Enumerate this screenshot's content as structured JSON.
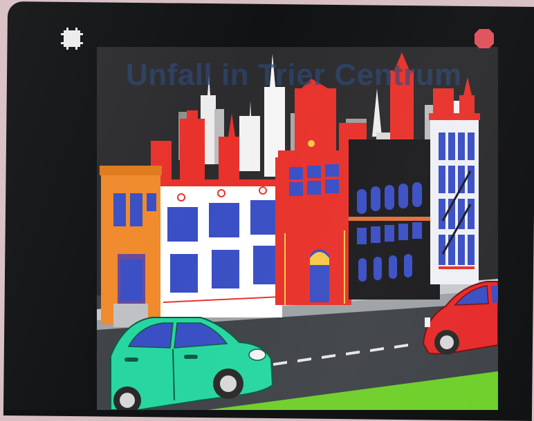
{
  "game": {
    "title": "Unfall in Trier Centrum"
  },
  "hud": {
    "left_icon": "frame-icon",
    "right_icon": "stop-icon"
  },
  "colors": {
    "bezel": "#111214",
    "sky": "#2c2c2f",
    "skyline_red": "#e8322b",
    "skyline_white": "#ececec",
    "skyline_gray": "#9a9a9a",
    "orange_house": "#f08a2c",
    "window_blue": "#3a4fc4",
    "road": "#3f4348",
    "grass": "#6fcf2a",
    "green_car": "#27d6a0",
    "red_car": "#e62b2b",
    "stop_button": "#e0505a"
  }
}
